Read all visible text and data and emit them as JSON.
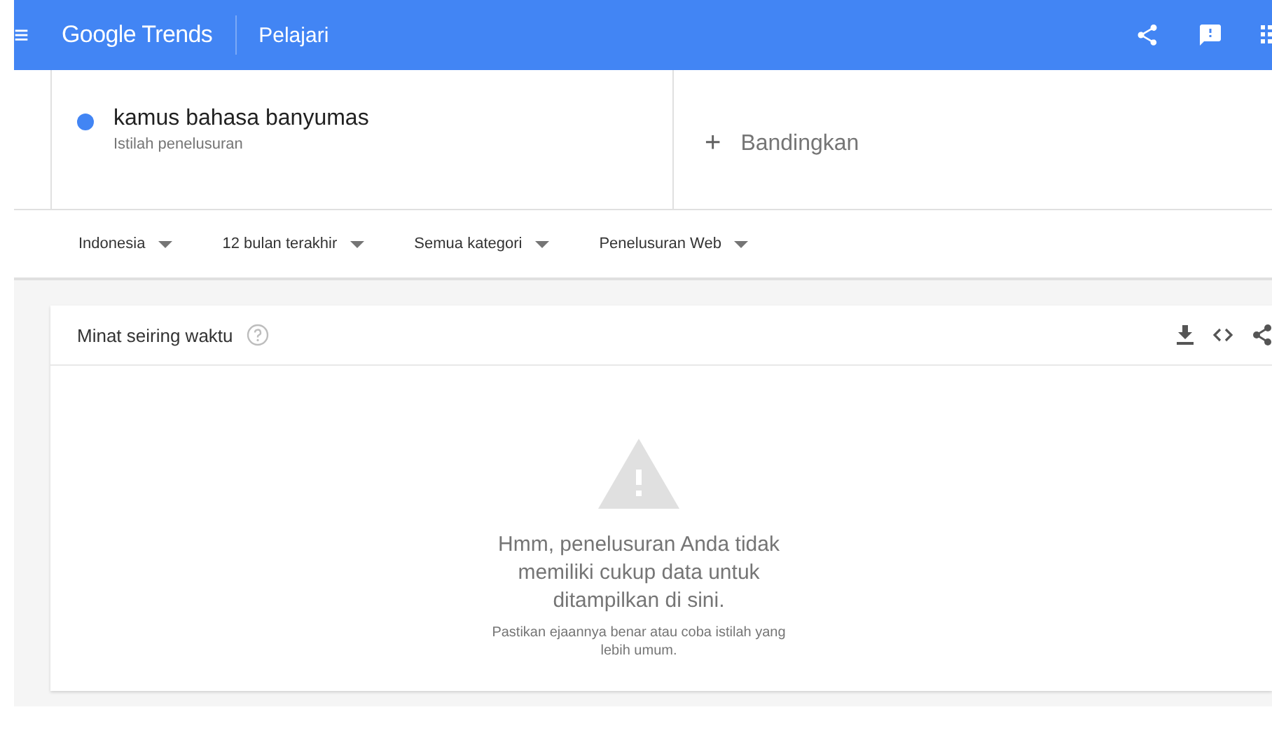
{
  "header": {
    "menu_icon": "≡",
    "logo": "Google Trends",
    "section": "Pelajari"
  },
  "terms": [
    {
      "name": "kamus bahasa banyumas",
      "subtitle": "Istilah penelusuran",
      "color": "#4285f4"
    }
  ],
  "compare": {
    "icon": "+",
    "label": "Bandingkan"
  },
  "filters": [
    "Indonesia",
    "12 bulan terakhir",
    "Semua kategori",
    "Penelusuran Web"
  ],
  "card": {
    "title": "Minat seiring waktu",
    "message": "Hmm, penelusuran Anda tidak memiliki cukup data untuk ditampilkan di sini.",
    "hint": "Pastikan ejaannya benar atau coba istilah yang lebih umum."
  }
}
